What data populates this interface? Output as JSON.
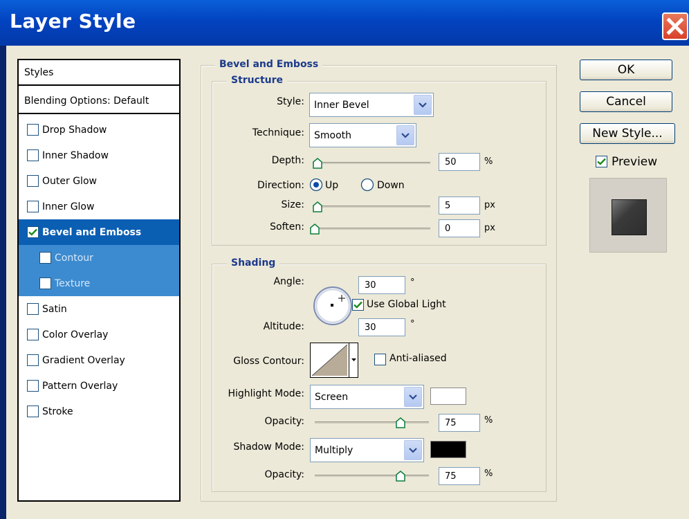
{
  "window": {
    "title": "Layer Style"
  },
  "styles_panel": {
    "header": "Styles",
    "blending": "Blending Options: Default",
    "items": [
      {
        "label": "Drop Shadow",
        "checked": false
      },
      {
        "label": "Inner Shadow",
        "checked": false
      },
      {
        "label": "Outer Glow",
        "checked": false
      },
      {
        "label": "Inner Glow",
        "checked": false
      },
      {
        "label": "Bevel and Emboss",
        "checked": true,
        "selected": true
      },
      {
        "label": "Contour",
        "checked": false,
        "sub": true
      },
      {
        "label": "Texture",
        "checked": false,
        "sub": true
      },
      {
        "label": "Satin",
        "checked": false
      },
      {
        "label": "Color Overlay",
        "checked": false
      },
      {
        "label": "Gradient Overlay",
        "checked": false
      },
      {
        "label": "Pattern Overlay",
        "checked": false
      },
      {
        "label": "Stroke",
        "checked": false
      }
    ]
  },
  "bevel": {
    "section_title": "Bevel and Emboss",
    "structure": {
      "title": "Structure",
      "style_label": "Style:",
      "style_value": "Inner Bevel",
      "technique_label": "Technique:",
      "technique_value": "Smooth",
      "depth_label": "Depth:",
      "depth_value": "50",
      "depth_unit": "%",
      "depth_level": 0.0,
      "direction_label": "Direction:",
      "direction_up": "Up",
      "direction_down": "Down",
      "direction_selected": "Up",
      "size_label": "Size:",
      "size_value": "5",
      "size_unit": "px",
      "size_level": 0.0,
      "soften_label": "Soften:",
      "soften_value": "0",
      "soften_unit": "px",
      "soften_level": 0.0
    },
    "shading": {
      "title": "Shading",
      "angle_label": "Angle:",
      "angle_value": "30",
      "angle_unit": "°",
      "global_light_label": "Use Global Light",
      "global_light_checked": true,
      "altitude_label": "Altitude:",
      "altitude_value": "30",
      "altitude_unit": "°",
      "gloss_label": "Gloss Contour:",
      "antialiased_label": "Anti-aliased",
      "antialiased_checked": false,
      "highlight_label": "Highlight Mode:",
      "highlight_value": "Screen",
      "highlight_color": "#ffffff",
      "opacity1_label": "Opacity:",
      "opacity1_value": "75",
      "opacity1_unit": "%",
      "opacity1_level": 0.75,
      "shadow_label": "Shadow Mode:",
      "shadow_value": "Multiply",
      "shadow_color": "#000000",
      "opacity2_label": "Opacity:",
      "opacity2_value": "75",
      "opacity2_unit": "%",
      "opacity2_level": 0.75
    }
  },
  "buttons": {
    "ok": "OK",
    "cancel": "Cancel",
    "new_style": "New Style..."
  },
  "preview": {
    "label": "Preview",
    "checked": true
  }
}
